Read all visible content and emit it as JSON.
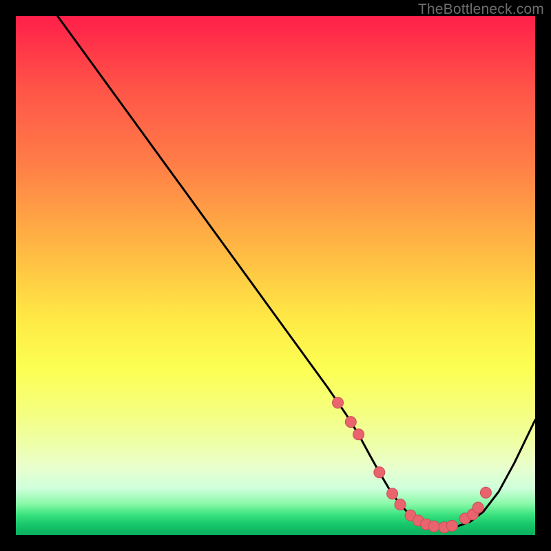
{
  "watermark": "TheBottleneck.com",
  "colors": {
    "background": "#000000",
    "line": "#000000",
    "marker_fill": "#e9646d",
    "marker_stroke": "#c94f57",
    "gradient_top": "#ff1f49",
    "gradient_bottom": "#0aae5e"
  },
  "chart_data": {
    "type": "line",
    "title": "",
    "xlabel": "",
    "ylabel": "",
    "xlim": [
      0,
      100
    ],
    "ylim": [
      0,
      100
    ],
    "grid": false,
    "series": [
      {
        "name": "bottleneck-curve",
        "x": [
          8,
          12,
          16,
          20,
          24,
          28,
          32,
          36,
          40,
          44,
          48,
          52,
          56,
          60,
          63.5,
          66,
          68,
          70,
          72,
          74,
          76,
          78,
          80,
          82.5,
          85,
          87.5,
          90,
          93,
          96,
          100
        ],
        "values": [
          100,
          94.5,
          89,
          83.5,
          78,
          72.5,
          67,
          61.5,
          56,
          50.5,
          45,
          39.5,
          34,
          28.5,
          23.4,
          19.4,
          15.7,
          12.1,
          8.7,
          5.9,
          3.8,
          2.4,
          1.7,
          1.5,
          1.7,
          2.6,
          4.5,
          8.4,
          13.9,
          22.2
        ]
      }
    ],
    "markers": {
      "name": "highlight-points",
      "x": [
        62,
        64.5,
        66,
        70,
        72.5,
        74,
        76,
        77.5,
        79,
        80.5,
        82.5,
        84,
        86.5,
        88,
        89,
        90.5
      ],
      "values": [
        25.5,
        21.8,
        19.4,
        12.1,
        8.0,
        5.9,
        3.8,
        2.8,
        2.1,
        1.7,
        1.5,
        1.8,
        3.2,
        4.0,
        5.3,
        8.2
      ]
    }
  }
}
